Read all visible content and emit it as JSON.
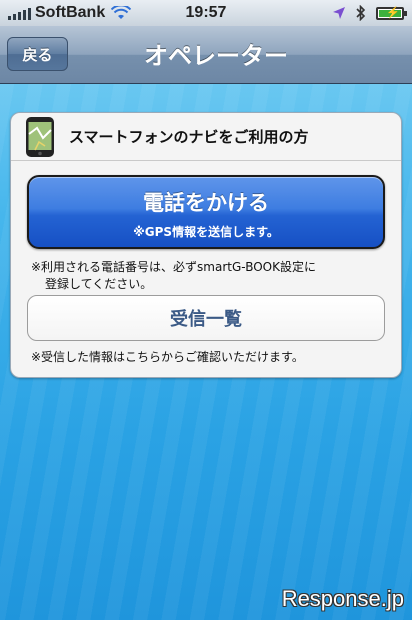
{
  "status_bar": {
    "carrier": "SoftBank",
    "time": "19:57",
    "icons": [
      "signal-bars-icon",
      "wifi-icon",
      "location-arrow-icon",
      "bluetooth-icon",
      "battery-charging-icon"
    ],
    "battery_level": 0.9
  },
  "nav": {
    "back_label": "戻る",
    "title": "オペレーター"
  },
  "card": {
    "header_icon": "smartphone-map-icon",
    "header_title": "スマートフォンのナビをご利用の方",
    "call_button": {
      "label": "電話をかける",
      "sub_label": "※GPS情報を送信します。"
    },
    "note_line1": "※利用される電話番号は、必ずsmartG-BOOK設定に",
    "note_line2": "登録してください。",
    "received_button_label": "受信一覧",
    "note2": "※受信した情報はこちらからご確認いただけます。"
  },
  "watermark": "Response.jp",
  "colors": {
    "background_top": "#7fd2f4",
    "background_bottom": "#1f95dc",
    "nav_bar": "#7690ad",
    "call_button": "#2463d3",
    "received_label": "#3b5a86"
  }
}
